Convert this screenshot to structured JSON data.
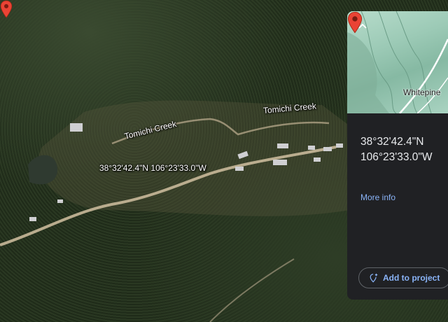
{
  "map": {
    "creek_label_1": "Tomichi Creek",
    "creek_label_2": "Tomichi Creek",
    "pin_coordinates": "38°32'42.4\"N 106°23'33.0\"W",
    "pin_icon": "map-pin-icon",
    "pin_color": "#ea4335"
  },
  "panel": {
    "collapse_icon": "chevron-up-icon",
    "mini_map_place": "Whitepine",
    "latitude": "38°32'42.4\"N",
    "longitude": "106°23'33.0\"W",
    "more_info_label": "More info",
    "add_to_project_label": "Add to project",
    "add_icon": "add-pin-icon",
    "accent_color": "#8ab4f8",
    "background_color": "#202124"
  }
}
